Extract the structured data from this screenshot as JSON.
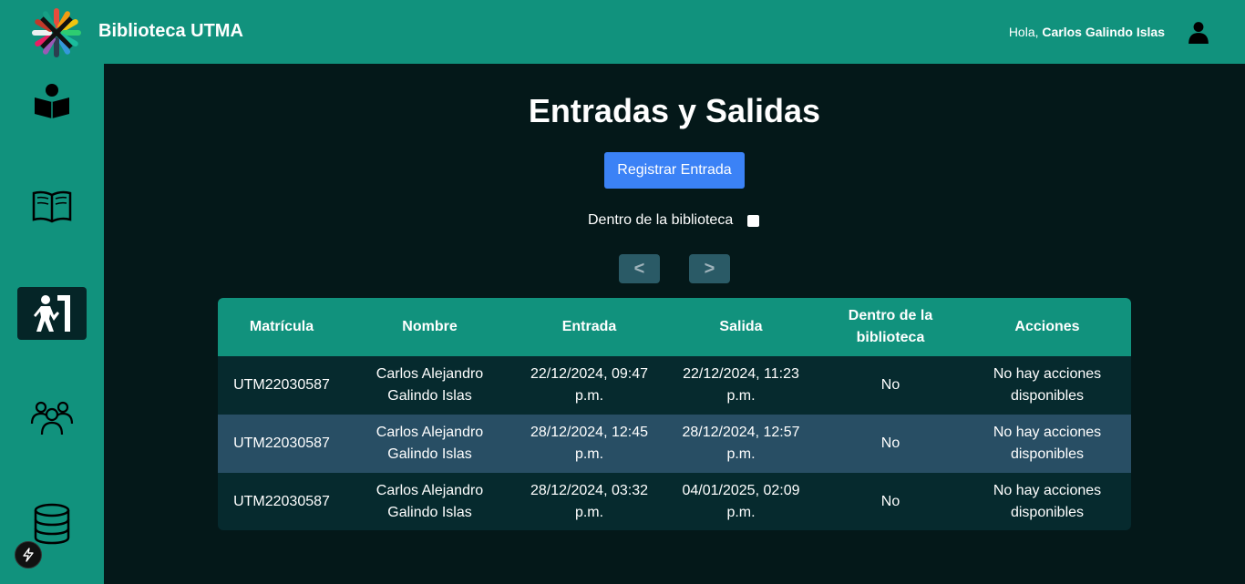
{
  "header": {
    "app_title": "Biblioteca UTMA",
    "greeting_prefix": "Hola,",
    "user_name": "Carlos Galindo Islas"
  },
  "sidebar": {
    "items": [
      {
        "name": "reader",
        "icon": "person-reading-icon",
        "active": false
      },
      {
        "name": "books",
        "icon": "open-book-icon",
        "active": false
      },
      {
        "name": "entries-exits",
        "icon": "person-exit-door-icon",
        "active": true
      },
      {
        "name": "users",
        "icon": "users-group-icon",
        "active": false
      },
      {
        "name": "database",
        "icon": "database-icon",
        "active": false
      }
    ]
  },
  "main": {
    "title": "Entradas y Salidas",
    "register_button": "Registrar Entrada",
    "filter_label": "Dentro de la biblioteca",
    "filter_checked": false,
    "prev_label": "<",
    "next_label": ">"
  },
  "table": {
    "headers": [
      "Matrícula",
      "Nombre",
      "Entrada",
      "Salida",
      "Dentro de la biblioteca",
      "Acciones"
    ],
    "rows": [
      [
        "UTM22030587",
        "Carlos Alejandro Galindo Islas",
        "22/12/2024, 09:47 p.m.",
        "22/12/2024, 11:23 p.m.",
        "No",
        "No hay acciones disponibles"
      ],
      [
        "UTM22030587",
        "Carlos Alejandro Galindo Islas",
        "28/12/2024, 12:45 p.m.",
        "28/12/2024, 12:57 p.m.",
        "No",
        "No hay acciones disponibles"
      ],
      [
        "UTM22030587",
        "Carlos Alejandro Galindo Islas",
        "28/12/2024, 03:32 p.m.",
        "04/01/2025, 02:09 p.m.",
        "No",
        "No hay acciones disponibles"
      ]
    ]
  },
  "colors": {
    "brand_teal": "#11927d",
    "background": "#041819",
    "primary_button": "#3b82f6",
    "row_odd": "#062a2e",
    "row_even": "#284e64"
  }
}
